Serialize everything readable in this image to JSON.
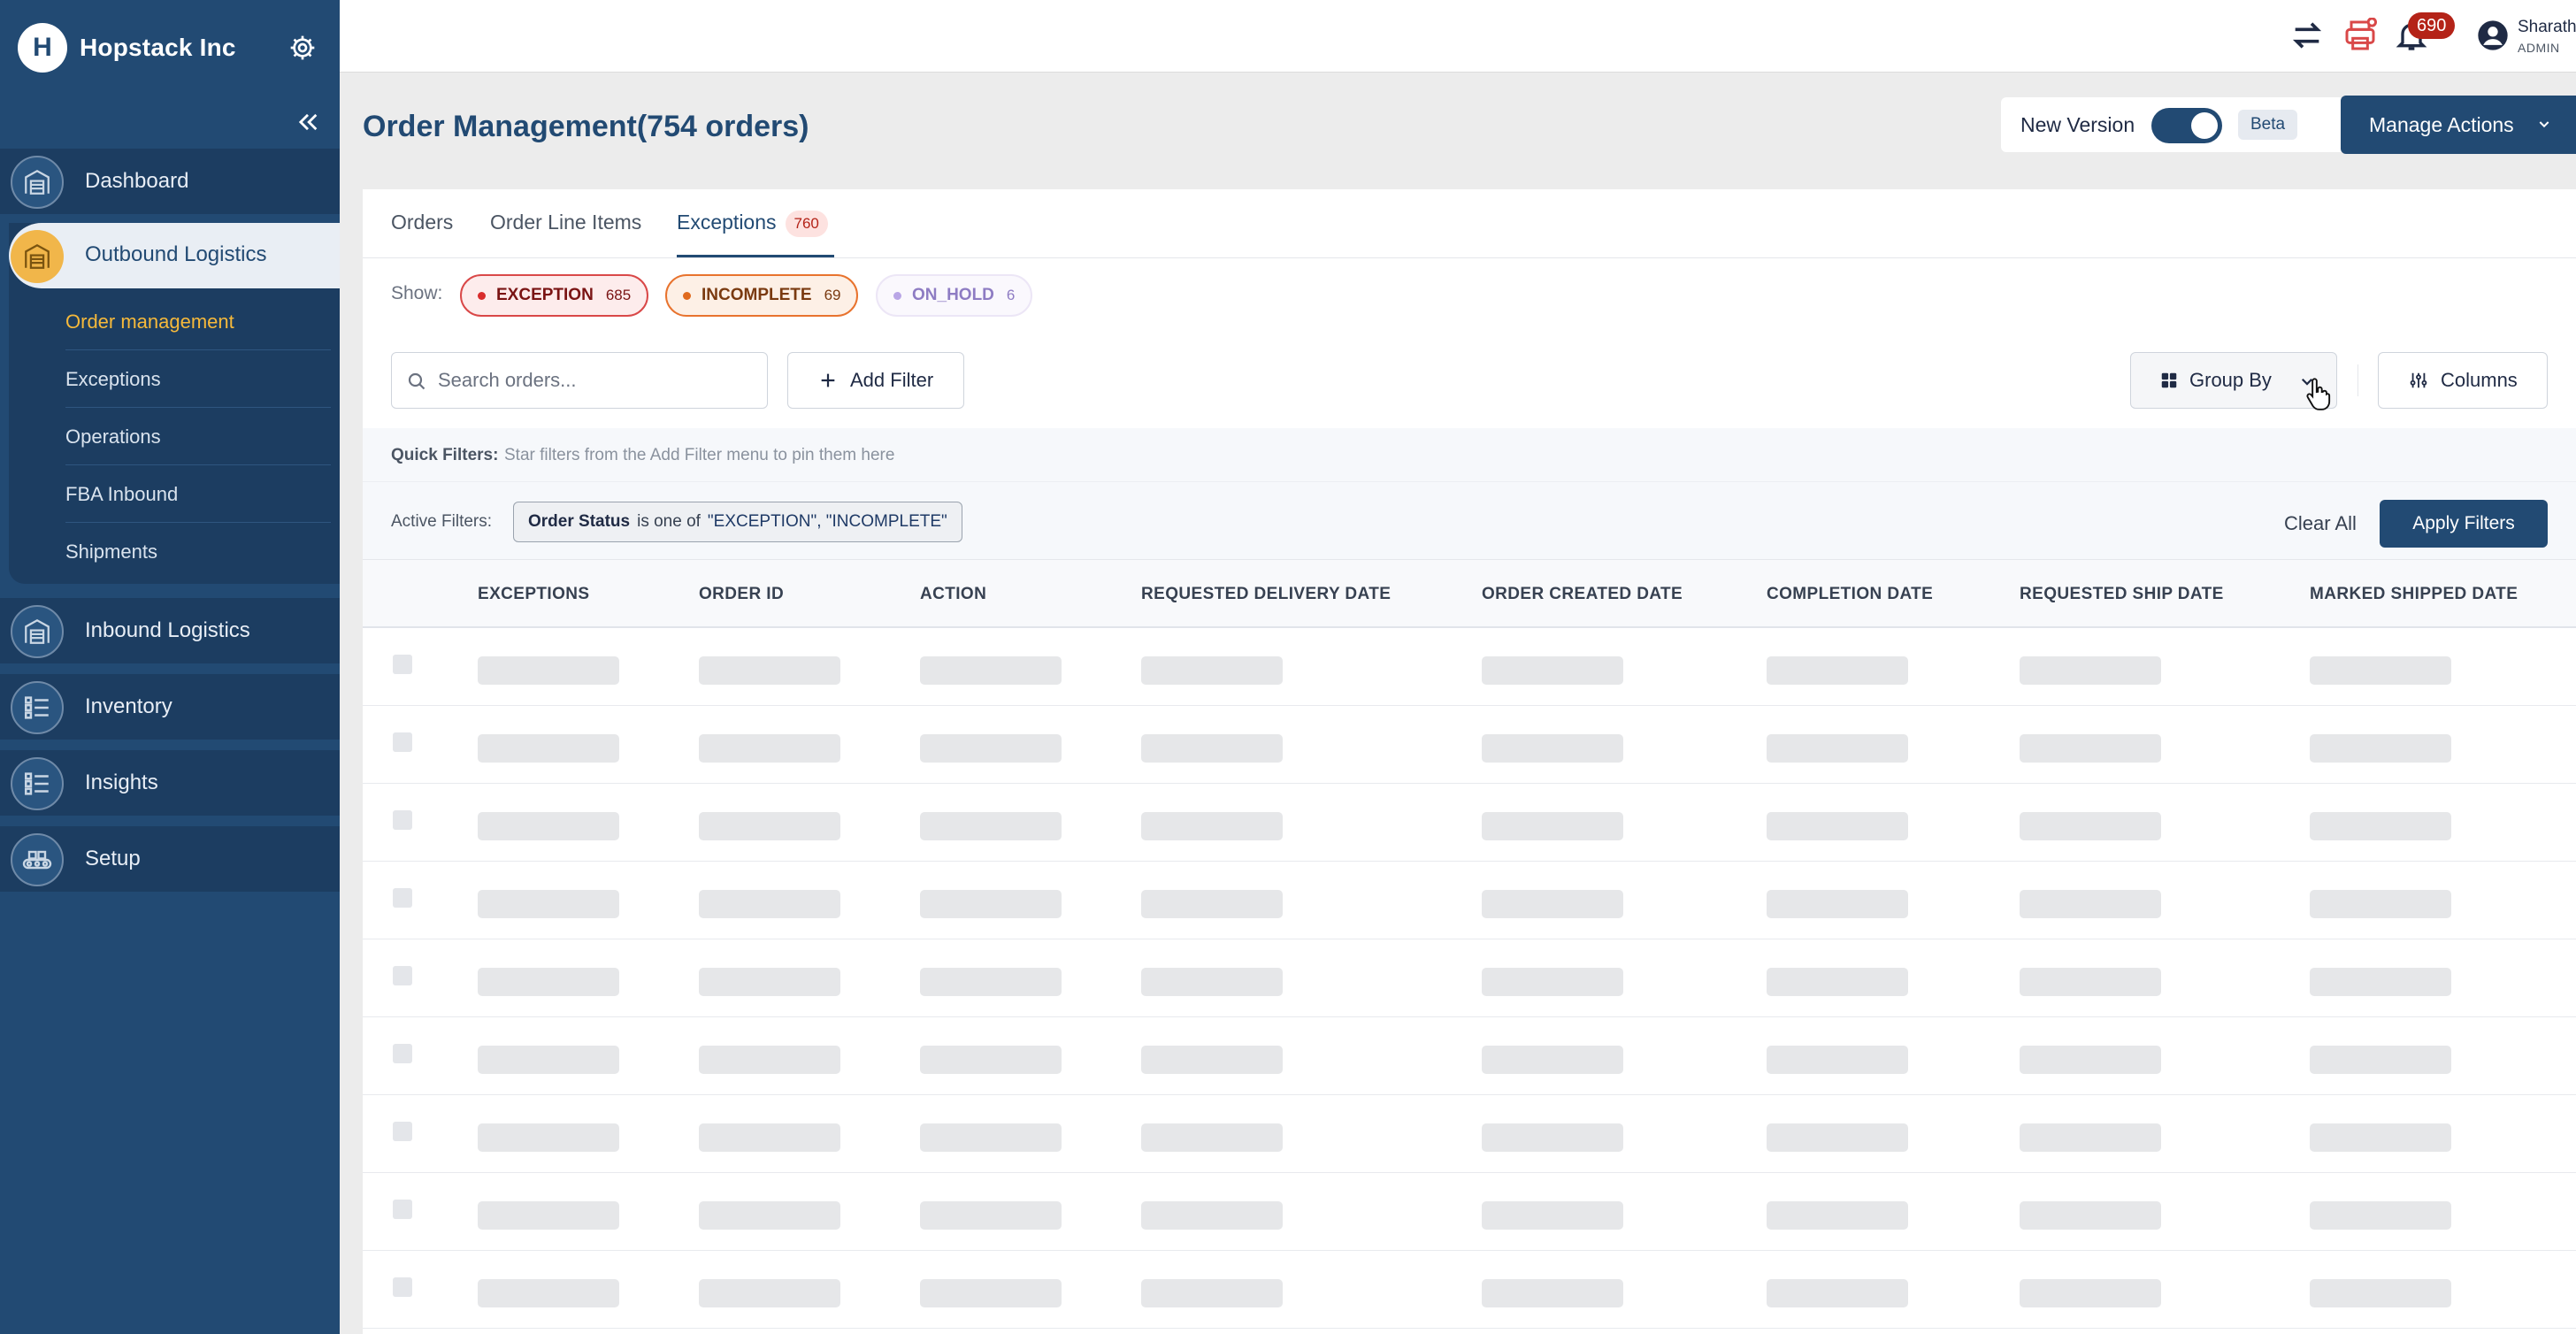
{
  "brand": {
    "name": "Hopstack Inc",
    "logo_letter": "H"
  },
  "sidebar": {
    "items": [
      {
        "label": "Dashboard",
        "icon": "warehouse-icon"
      },
      {
        "label": "Outbound Logistics",
        "icon": "warehouse-icon",
        "active": true,
        "children": [
          {
            "label": "Order management",
            "active": true
          },
          {
            "label": "Exceptions"
          },
          {
            "label": "Operations"
          },
          {
            "label": "FBA Inbound"
          },
          {
            "label": "Shipments"
          }
        ]
      },
      {
        "label": "Inbound Logistics",
        "icon": "warehouse-icon"
      },
      {
        "label": "Inventory",
        "icon": "checklist-icon"
      },
      {
        "label": "Insights",
        "icon": "checklist-icon"
      },
      {
        "label": "Setup",
        "icon": "setup-icon"
      }
    ]
  },
  "topbar": {
    "notifications_count": "690",
    "user_name": "Sharath",
    "user_role": "ADMIN"
  },
  "header": {
    "title": "Order Management(754 orders)",
    "version_label": "New Version",
    "version_badge": "Beta",
    "manage_actions": "Manage Actions"
  },
  "tabs": [
    {
      "label": "Orders"
    },
    {
      "label": "Order Line Items"
    },
    {
      "label": "Exceptions",
      "count": "760",
      "active": true
    }
  ],
  "show": {
    "label": "Show:",
    "pills": [
      {
        "label": "EXCEPTION",
        "count": "685"
      },
      {
        "label": "INCOMPLETE",
        "count": "69"
      },
      {
        "label": "ON_HOLD",
        "count": "6"
      }
    ]
  },
  "toolbar": {
    "search_placeholder": "Search orders...",
    "add_filter": "Add Filter",
    "group_by": "Group By",
    "columns": "Columns"
  },
  "quick_filters": {
    "label": "Quick Filters:",
    "hint": "Star filters from the Add Filter menu to pin them here"
  },
  "active_filters": {
    "label": "Active Filters:",
    "chip_field": "Order Status",
    "chip_op": "is one of",
    "chip_values": "\"EXCEPTION\", \"INCOMPLETE\"",
    "clear_all": "Clear All",
    "apply": "Apply Filters"
  },
  "table": {
    "columns": [
      "EXCEPTIONS",
      "ORDER ID",
      "ACTION",
      "REQUESTED DELIVERY DATE",
      "ORDER CREATED DATE",
      "COMPLETION DATE",
      "REQUESTED SHIP DATE",
      "MARKED SHIPPED DATE"
    ],
    "loading_rows": 9
  },
  "colors": {
    "primary": "#224a73",
    "accent": "#f1b64a",
    "danger": "#b42318"
  }
}
